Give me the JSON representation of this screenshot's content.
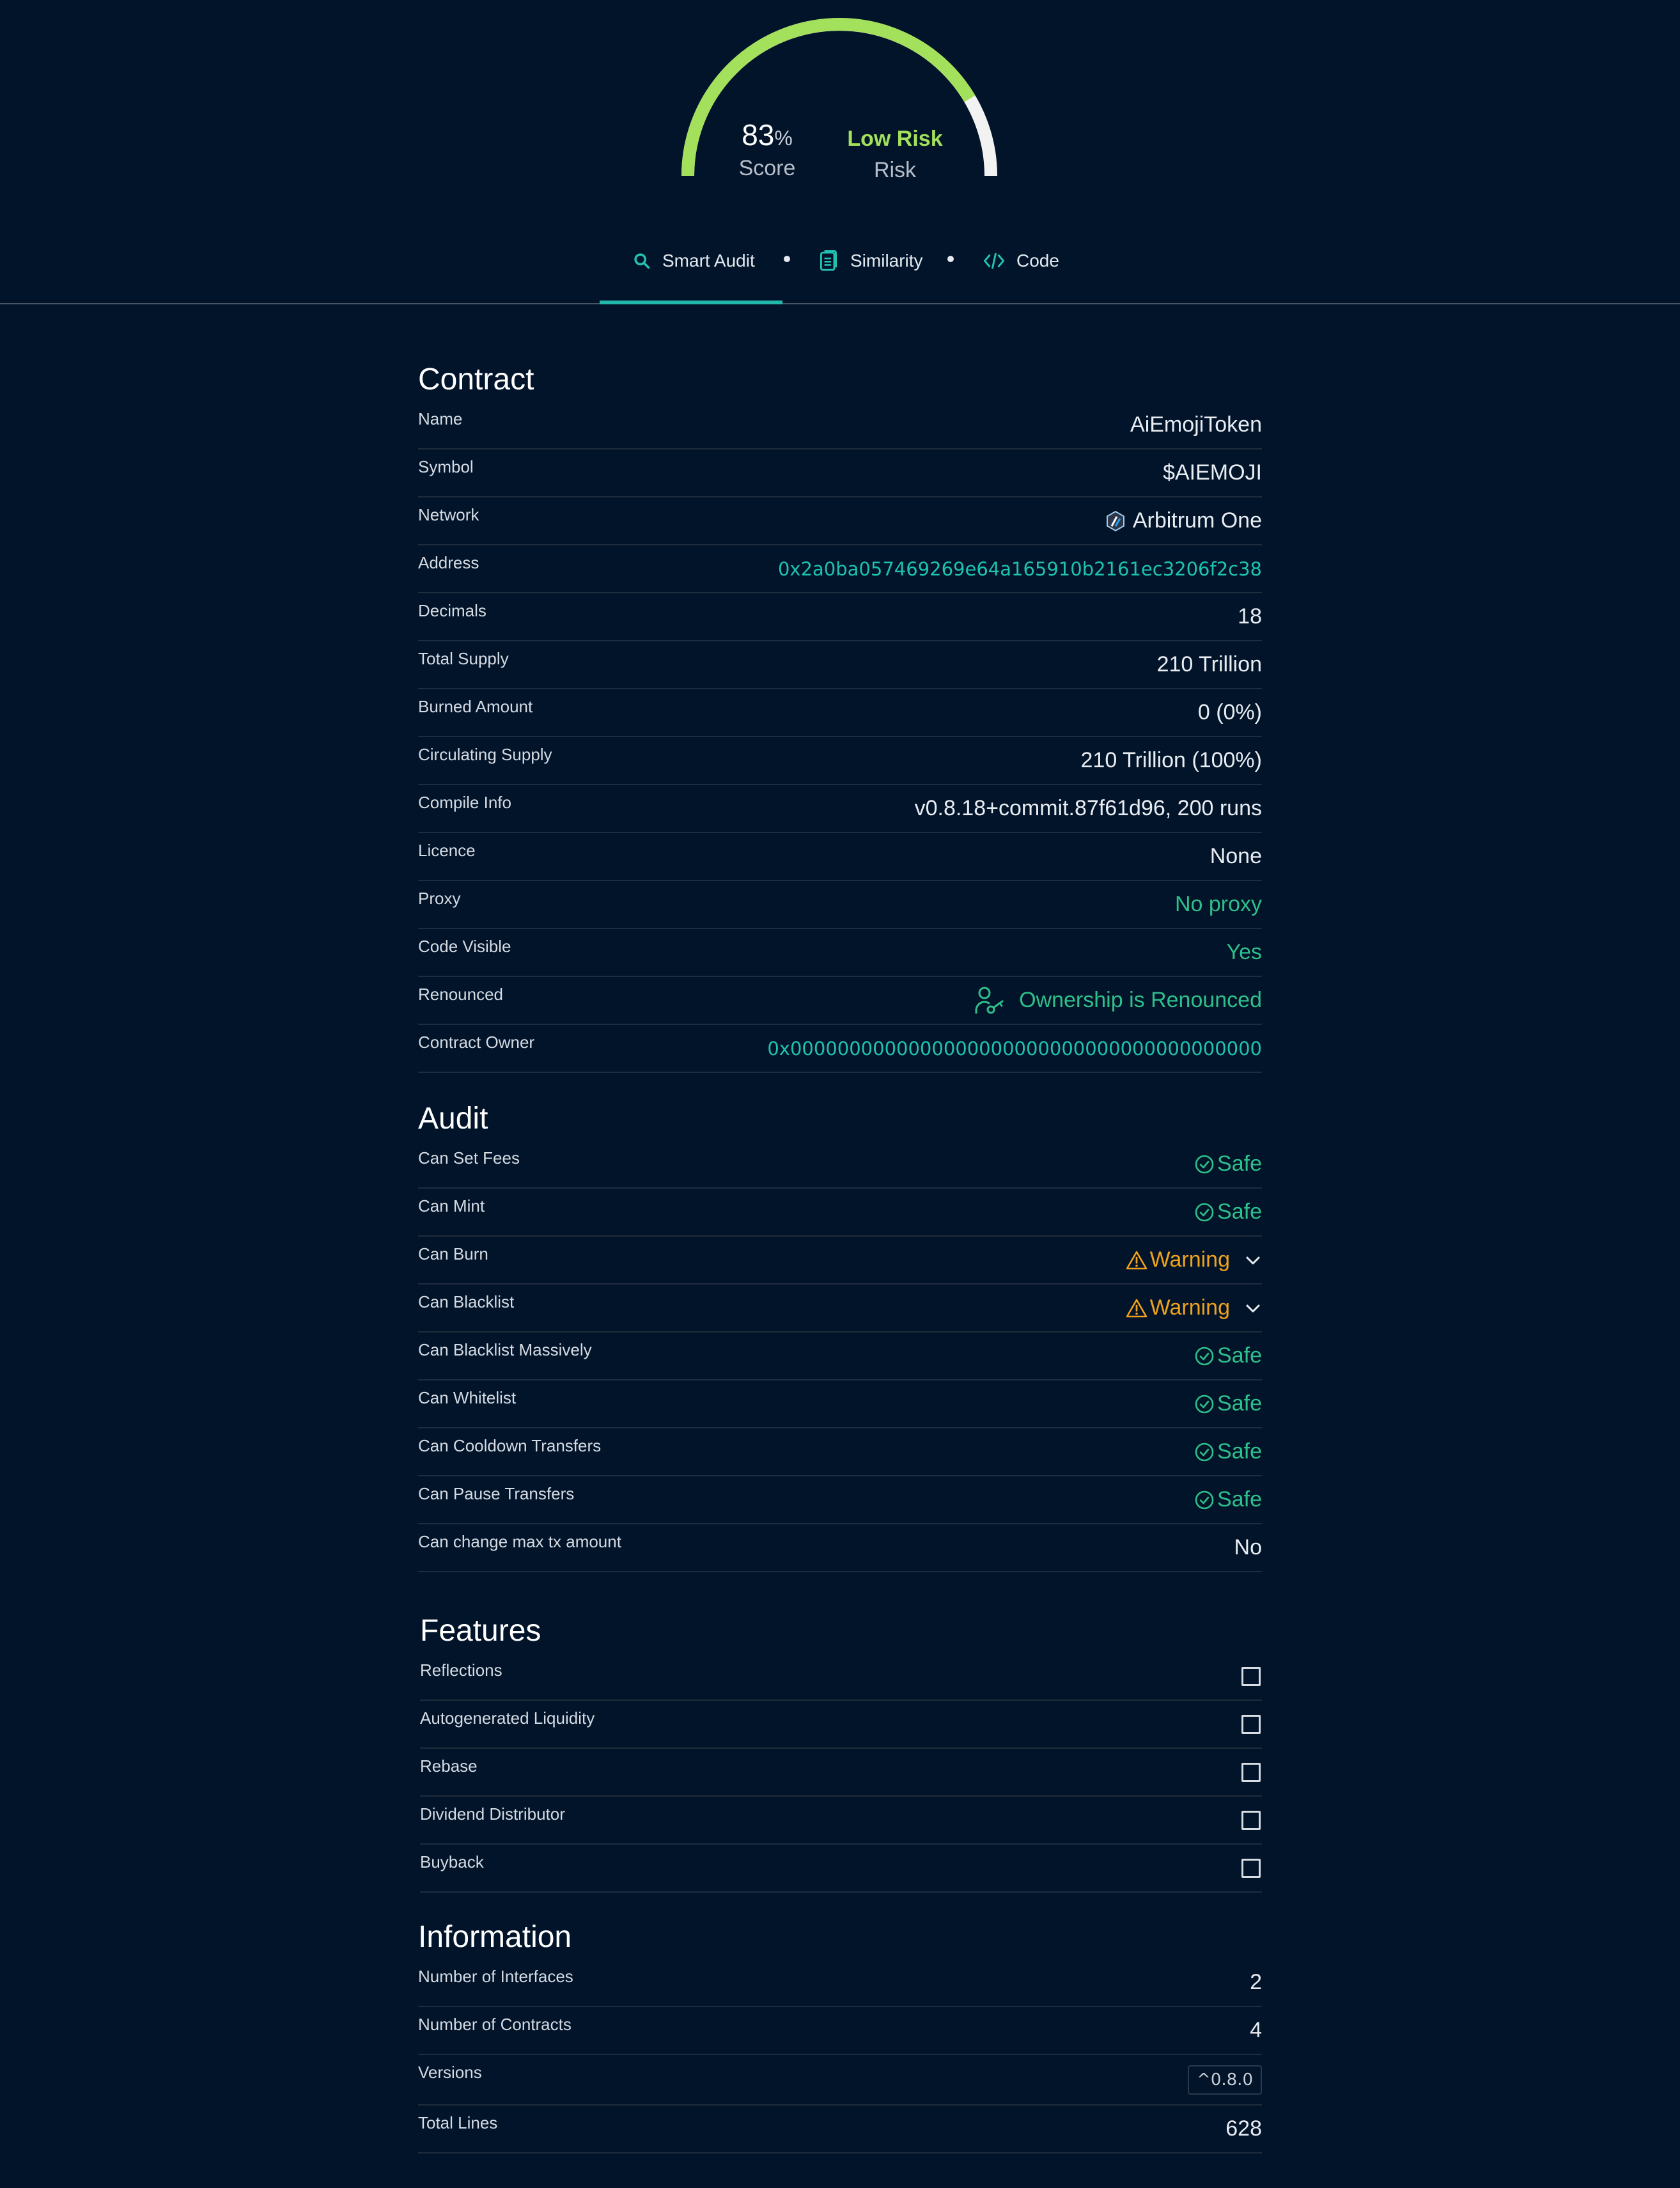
{
  "gauge": {
    "score": "83",
    "score_unit": "%",
    "score_label": "Score",
    "score_fraction": 0.83,
    "risk_value": "Low Risk",
    "risk_label": "Risk",
    "fill_color": "#a3e05c",
    "track_color": "#f2f2f2"
  },
  "tabs": [
    {
      "label": "Smart Audit",
      "icon": "search-icon",
      "active": true
    },
    {
      "label": "Similarity",
      "icon": "document-icon",
      "active": false
    },
    {
      "label": "Code",
      "icon": "code-icon",
      "active": false
    }
  ],
  "contract": {
    "title": "Contract",
    "rows": [
      {
        "label": "Name",
        "value": "AiEmojiToken"
      },
      {
        "label": "Symbol",
        "value": "$AIEMOJI"
      },
      {
        "label": "Network",
        "value": "Arbitrum One",
        "icon": "arbitrum-icon"
      },
      {
        "label": "Address",
        "value": "0x2a0ba057469269e64a165910b2161ec3206f2c38"
      },
      {
        "label": "Decimals",
        "value": "18"
      },
      {
        "label": "Total Supply",
        "value": "210 Trillion"
      },
      {
        "label": "Burned Amount",
        "value": "0 (0%)"
      },
      {
        "label": "Circulating Supply",
        "value": "210 Trillion (100%)"
      },
      {
        "label": "Compile Info",
        "value": "v0.8.18+commit.87f61d96, 200 runs"
      },
      {
        "label": "Licence",
        "value": "None"
      },
      {
        "label": "Proxy",
        "value": "No proxy"
      },
      {
        "label": "Code Visible",
        "value": "Yes"
      },
      {
        "label": "Renounced",
        "value": "Ownership is Renounced",
        "icon": "user-key-icon"
      },
      {
        "label": "Contract Owner",
        "value": "0x0000000000000000000000000000000000000000"
      }
    ]
  },
  "audit": {
    "title": "Audit",
    "rows": [
      {
        "label": "Can Set Fees",
        "value": "Safe",
        "status": "safe"
      },
      {
        "label": "Can Mint",
        "value": "Safe",
        "status": "safe"
      },
      {
        "label": "Can Burn",
        "value": "Warning",
        "status": "warning"
      },
      {
        "label": "Can Blacklist",
        "value": "Warning",
        "status": "warning"
      },
      {
        "label": "Can Blacklist Massively",
        "value": "Safe",
        "status": "safe"
      },
      {
        "label": "Can Whitelist",
        "value": "Safe",
        "status": "safe"
      },
      {
        "label": "Can Cooldown Transfers",
        "value": "Safe",
        "status": "safe"
      },
      {
        "label": "Can Pause Transfers",
        "value": "Safe",
        "status": "safe"
      },
      {
        "label": "Can change max tx amount",
        "value": "No",
        "status": "plain"
      }
    ]
  },
  "features": {
    "title": "Features",
    "rows": [
      {
        "label": "Reflections",
        "checked": false
      },
      {
        "label": "Autogenerated Liquidity",
        "checked": false
      },
      {
        "label": "Rebase",
        "checked": false
      },
      {
        "label": "Dividend Distributor",
        "checked": false
      },
      {
        "label": "Buyback",
        "checked": false
      }
    ]
  },
  "information": {
    "title": "Information",
    "rows": [
      {
        "label": "Number of Interfaces",
        "value": "2"
      },
      {
        "label": "Number of Contracts",
        "value": "4"
      },
      {
        "label": "Versions",
        "value": "^0.8.0"
      },
      {
        "label": "Total Lines",
        "value": "628"
      }
    ]
  }
}
